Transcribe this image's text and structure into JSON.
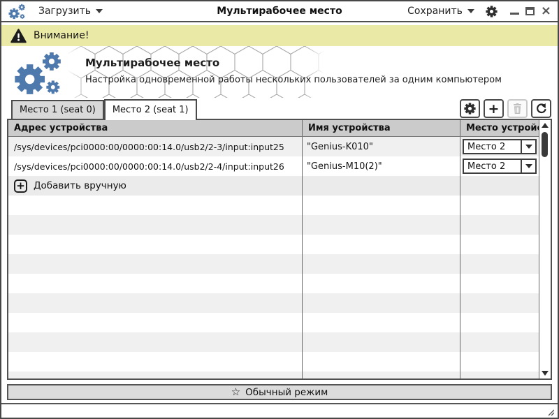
{
  "titlebar": {
    "app_title": "Мультирабочее место",
    "load_menu": "Загрузить",
    "save_menu": "Сохранить"
  },
  "warning_bar": {
    "label": "Внимание!"
  },
  "header": {
    "title": "Мультирабочее место",
    "subtitle": "Настройка одновременной работы нескольких пользователей за одним компьютером"
  },
  "tabs": {
    "tab1": "Место 1 (seat 0)",
    "tab2": "Место 2 (seat 1)"
  },
  "table": {
    "col_address": "Адрес устройства",
    "col_name": "Имя устройства",
    "col_seat": "Место устройства",
    "rows": [
      {
        "address": "/sys/devices/pci0000:00/0000:00:14.0/usb2/2-3/input:input25",
        "name": "\"Genius-K010\"",
        "seat": "Место 2"
      },
      {
        "address": "/sys/devices/pci0000:00/0000:00:14.0/usb2/2-4/input:input26",
        "name": "\"Genius-M10(2)\"",
        "seat": "Место 2"
      }
    ],
    "add_manual_label": "Добавить вручную"
  },
  "footer": {
    "mode_button": "Обычный режим"
  },
  "icons": {
    "plus": "+",
    "close": "×",
    "star": "☆"
  },
  "colors": {
    "accent_blue": "#4e79ad",
    "warning_bg": "#ebe9a6",
    "header_gray": "#cbcbcb",
    "row_alt": "#f0f0f0"
  }
}
